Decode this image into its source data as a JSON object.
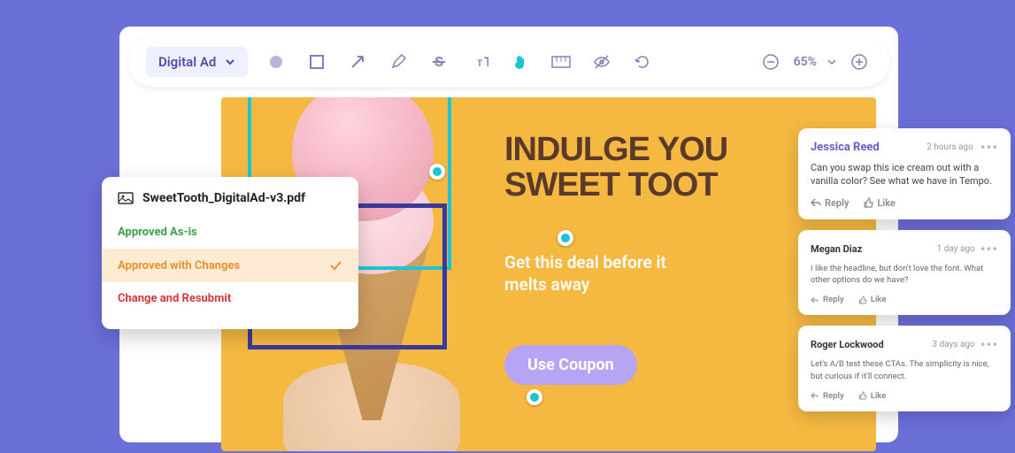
{
  "toolbar": {
    "dropdown_label": "Digital Ad",
    "zoom": "65%"
  },
  "canvas": {
    "headline_line1": "INDULGE YOU",
    "headline_line2": "SWEET TOOT",
    "subhead_line1": "Get this deal before it",
    "subhead_line2": "melts away",
    "cta": "Use Coupon"
  },
  "approval": {
    "filename": "SweetTooth_DigitalAd-v3.pdf",
    "options": [
      {
        "label": "Approved As-is"
      },
      {
        "label": "Approved with Changes"
      },
      {
        "label": "Change and Resubmit"
      }
    ]
  },
  "comments": [
    {
      "name": "Jessica Reed",
      "time": "2 hours ago",
      "body": "Can you swap this ice cream out with a vanilla color? See what we have in Tempo.",
      "reply": "Reply",
      "like": "Like"
    },
    {
      "name": "Megan Diaz",
      "time": "1 day ago",
      "body": "I like the headline, but don't love the font. What other options do we have?",
      "reply": "Reply",
      "like": "Like"
    },
    {
      "name": "Roger Lockwood",
      "time": "3 days ago",
      "body": "Let's A/B test these CTAs. The simplicity is nice, but curious if it'll connect.",
      "reply": "Reply",
      "like": "Like"
    }
  ]
}
